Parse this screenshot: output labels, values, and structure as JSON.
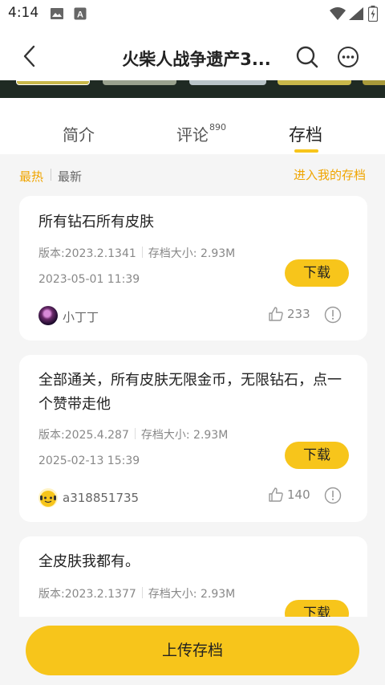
{
  "status_bar": {
    "time": "4:14",
    "icons": [
      "photo-icon",
      "a-icon",
      "wifi-icon",
      "signal-icon",
      "battery-icon"
    ]
  },
  "header": {
    "title": "火柴人战争遗产3...",
    "back_icon": "chevron-left-icon",
    "search_icon": "search-icon",
    "more_icon": "more-horizontal-icon"
  },
  "tabs": [
    {
      "label": "简介",
      "badge": ""
    },
    {
      "label": "评论",
      "badge": "890"
    },
    {
      "label": "存档",
      "badge": "",
      "active": true
    }
  ],
  "filter": {
    "hot": "最热",
    "new": "最新",
    "my_archive": "进入我的存档"
  },
  "archives": [
    {
      "title": "所有钻石所有皮肤",
      "version": "版本:2023.2.1341",
      "size": "存档大小: 2.93M",
      "date": "2023-05-01 11:39",
      "download": "下载",
      "user": "小丁丁",
      "likes": "233"
    },
    {
      "title": "全部通关，所有皮肤无限金币，无限钻石，点一个赞带走他",
      "version": "版本:2025.4.287",
      "size": "存档大小: 2.93M",
      "date": "2025-02-13 15:39",
      "download": "下载",
      "user": "a318851735",
      "likes": "140"
    },
    {
      "title": "全皮肤我都有。",
      "version": "版本:2023.2.1377",
      "size": "存档大小: 2.93M",
      "date": "",
      "download": "下载",
      "user": "",
      "likes": ""
    }
  ],
  "upload_label": "上传存档",
  "colors": {
    "accent": "#f7c51b",
    "accent_text": "#f0a500",
    "background": "#f5f5f5"
  }
}
